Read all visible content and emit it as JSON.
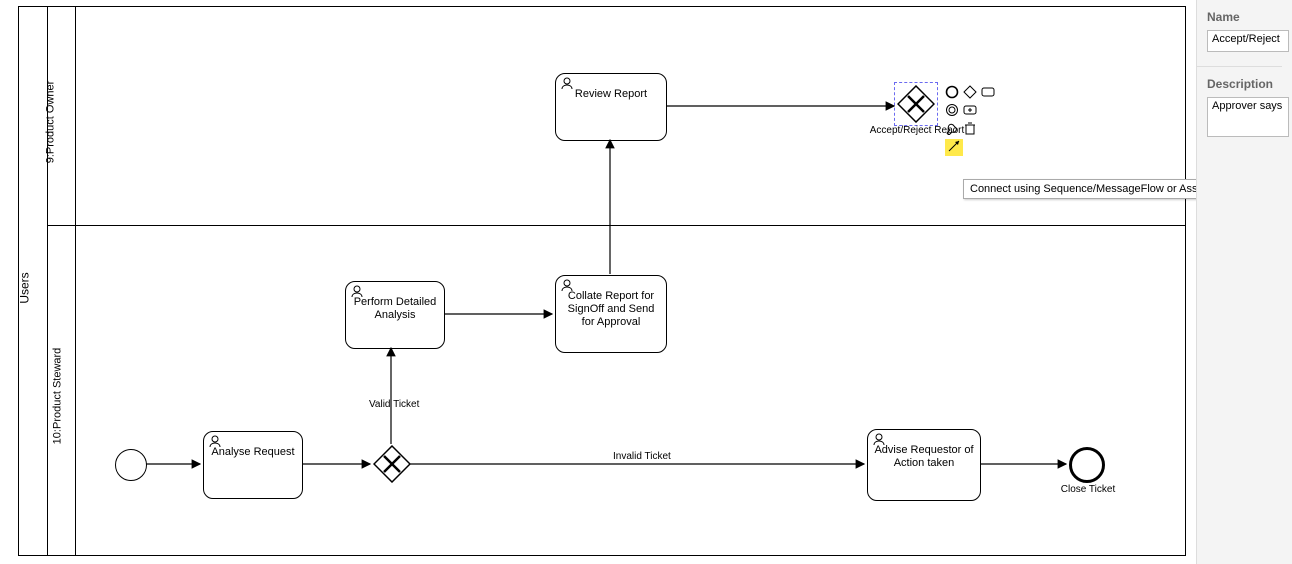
{
  "pool": {
    "title": "Users"
  },
  "lanes": {
    "owner": {
      "title": "9:Product Owner"
    },
    "steward": {
      "title": "10:Product Steward"
    }
  },
  "tasks": {
    "review": {
      "label": "Review Report"
    },
    "perform": {
      "label": "Perform Detailed Analysis"
    },
    "collate": {
      "label": "Collate Report for SignOff and Send for Approval"
    },
    "analyse": {
      "label": "Analyse Request"
    },
    "advise": {
      "label": "Advise Requestor of Action taken"
    }
  },
  "gateways": {
    "accept": {
      "label": "Accept/Reject Report"
    },
    "branch": {
      "label": ""
    }
  },
  "events": {
    "end": {
      "label": "Close Ticket"
    }
  },
  "flows": {
    "valid": {
      "label": "Valid Ticket"
    },
    "invalid": {
      "label": "Invalid Ticket"
    }
  },
  "tooltip": "Connect using Sequence/MessageFlow or Association",
  "panel": {
    "nameLabel": "Name",
    "nameValue": "Accept/Reject",
    "descLabel": "Description",
    "descValue": "Approver says"
  }
}
